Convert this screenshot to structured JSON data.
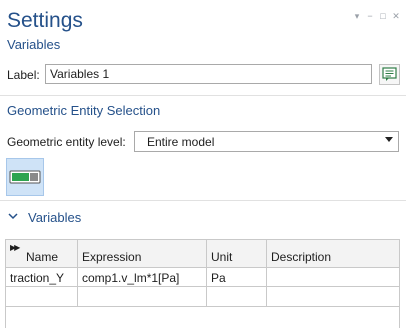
{
  "header": {
    "title": "Settings",
    "subtitle": "Variables"
  },
  "label_field": {
    "label": "Label:",
    "value": "Variables 1"
  },
  "geometric_selection": {
    "section_title": "Geometric Entity Selection",
    "level_label": "Geometric entity level:",
    "level_value": "Entire model"
  },
  "variables": {
    "section_title": "Variables",
    "columns": [
      "Name",
      "Expression",
      "Unit",
      "Description"
    ],
    "rows": [
      {
        "name": "traction_Y",
        "expression": "comp1.v_lm*1[Pa]",
        "unit": "Pa",
        "description": ""
      }
    ]
  },
  "colors": {
    "heading": "#25518a",
    "toggle_bg": "#cfe3f7",
    "toggle_green": "#2ea44f"
  }
}
